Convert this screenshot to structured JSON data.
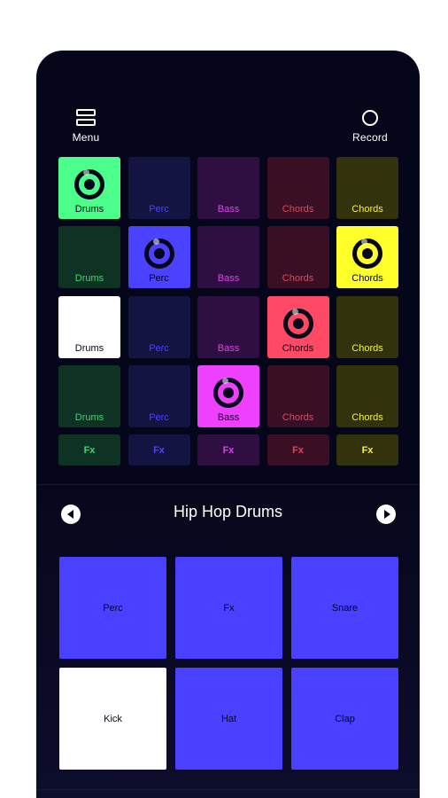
{
  "topbar": {
    "menu_label": "Menu",
    "record_label": "Record"
  },
  "colors": {
    "drums": "#4cff8a",
    "perc": "#4a42ff",
    "bass": "#f040ff",
    "chords": "#ff4a66",
    "chords_alt": "#ffff2a",
    "pad_blue": "#4a40ff",
    "pad_active": "#ffffff"
  },
  "grid": {
    "rows": [
      [
        {
          "label": "Drums",
          "bg": "#4cff8a",
          "fg": "#06061a",
          "active": true
        },
        {
          "label": "Perc",
          "bg": "#141443",
          "fg": "#4a42ff",
          "active": false
        },
        {
          "label": "Bass",
          "bg": "#2f0f42",
          "fg": "#e040f0",
          "active": false
        },
        {
          "label": "Chords",
          "bg": "#3a0f23",
          "fg": "#e8445f",
          "active": false
        },
        {
          "label": "Chords",
          "bg": "#32320c",
          "fg": "#f4f43a",
          "active": false
        }
      ],
      [
        {
          "label": "Drums",
          "bg": "#0f3322",
          "fg": "#3ad67a",
          "active": false
        },
        {
          "label": "Perc",
          "bg": "#4a42ff",
          "fg": "#06061a",
          "active": true
        },
        {
          "label": "Bass",
          "bg": "#2f0f42",
          "fg": "#e040f0",
          "active": false
        },
        {
          "label": "Chords",
          "bg": "#3a0f23",
          "fg": "#e8445f",
          "active": false
        },
        {
          "label": "Chords",
          "bg": "#ffff2a",
          "fg": "#06061a",
          "active": true
        }
      ],
      [
        {
          "label": "Drums",
          "bg": "#ffffff",
          "fg": "#06061a",
          "active": false,
          "solid": true
        },
        {
          "label": "Perc",
          "bg": "#141443",
          "fg": "#4a42ff",
          "active": false
        },
        {
          "label": "Bass",
          "bg": "#2f0f42",
          "fg": "#e040f0",
          "active": false
        },
        {
          "label": "Chords",
          "bg": "#ff4a66",
          "fg": "#06061a",
          "active": true
        },
        {
          "label": "Chords",
          "bg": "#32320c",
          "fg": "#f4f43a",
          "active": false
        }
      ],
      [
        {
          "label": "Drums",
          "bg": "#0f3322",
          "fg": "#3ad67a",
          "active": false
        },
        {
          "label": "Perc",
          "bg": "#141443",
          "fg": "#4a42ff",
          "active": false
        },
        {
          "label": "Bass",
          "bg": "#f040ff",
          "fg": "#06061a",
          "active": true
        },
        {
          "label": "Chords",
          "bg": "#3a0f23",
          "fg": "#e8445f",
          "active": false
        },
        {
          "label": "Chords",
          "bg": "#32320c",
          "fg": "#f4f43a",
          "active": false
        }
      ]
    ],
    "fx_row": [
      {
        "label": "Fx",
        "bg": "#0f3322",
        "fg": "#3ad67a"
      },
      {
        "label": "Fx",
        "bg": "#141443",
        "fg": "#4a42ff"
      },
      {
        "label": "Fx",
        "bg": "#2f0f42",
        "fg": "#e040f0"
      },
      {
        "label": "Fx",
        "bg": "#3a0f23",
        "fg": "#e8445f"
      },
      {
        "label": "Fx",
        "bg": "#32320c",
        "fg": "#f4f43a"
      }
    ]
  },
  "kit": {
    "title": "Hip Hop Drums"
  },
  "pads": [
    {
      "label": "Perc",
      "bg": "#4a40ff"
    },
    {
      "label": "Fx",
      "bg": "#4a40ff"
    },
    {
      "label": "Snare",
      "bg": "#4a40ff"
    },
    {
      "label": "Kick",
      "bg": "#ffffff"
    },
    {
      "label": "Hat",
      "bg": "#4a40ff"
    },
    {
      "label": "Clap",
      "bg": "#4a40ff"
    }
  ]
}
